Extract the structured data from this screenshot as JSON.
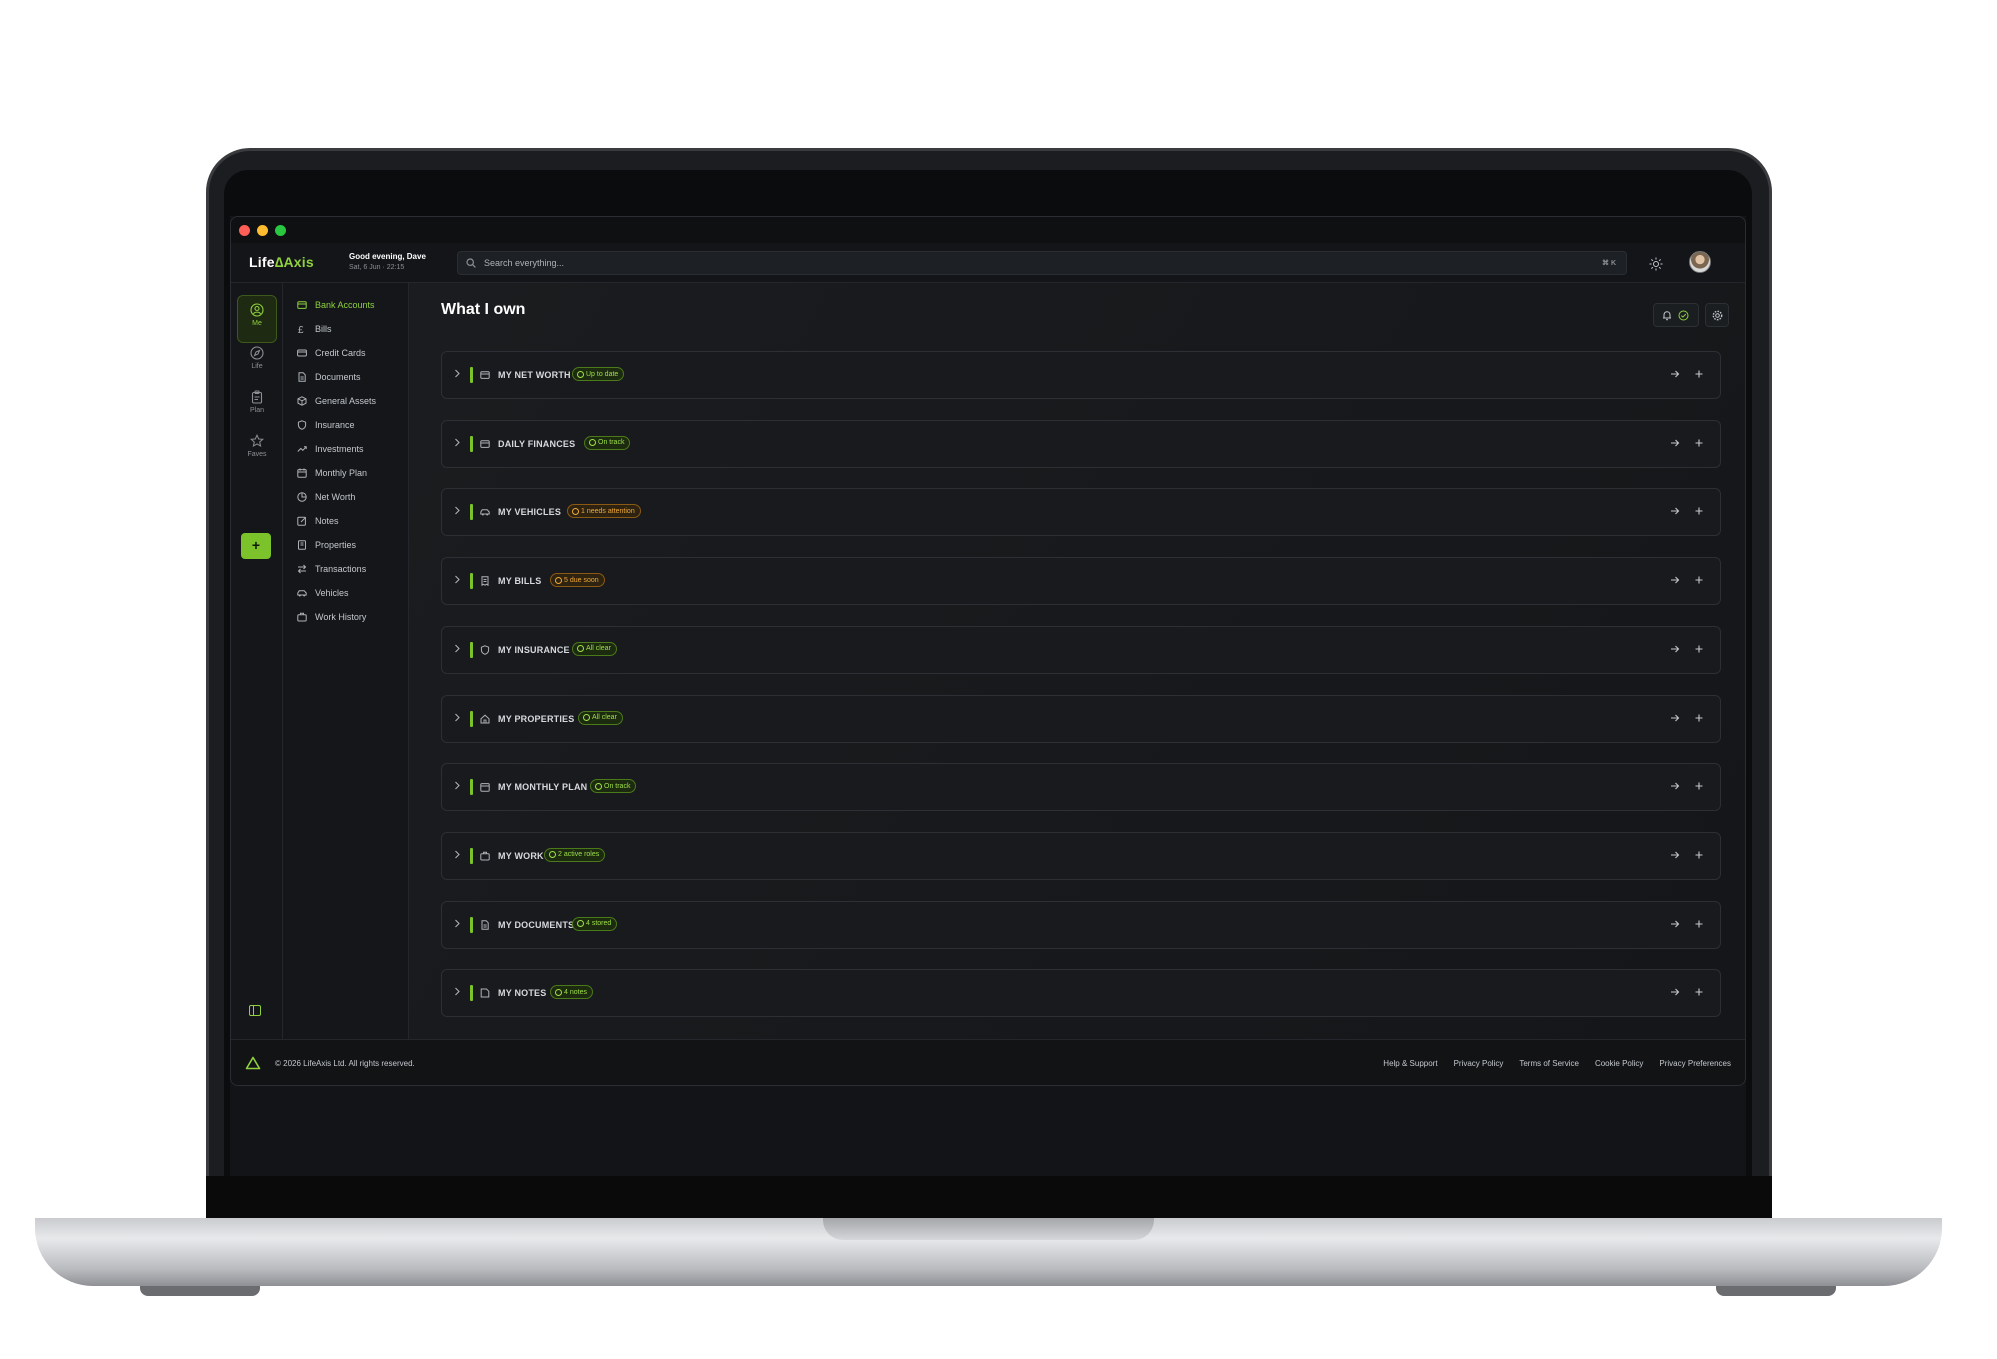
{
  "app": {
    "brand_prefix": "Life",
    "brand_suffix": "Axis",
    "greeting": "Good evening, Dave",
    "date": "Sat, 6 Jun · 22:15"
  },
  "search": {
    "placeholder": "Search everything...",
    "shortcut": "⌘ K"
  },
  "rail": {
    "items": [
      {
        "label": "Me",
        "icon": "user-icon"
      },
      {
        "label": "Life",
        "icon": "compass-icon"
      },
      {
        "label": "Plan",
        "icon": "clipboard-icon"
      },
      {
        "label": "Faves",
        "icon": "star-icon"
      }
    ],
    "add_label": "+"
  },
  "sidebar": {
    "items": [
      {
        "label": "Bank Accounts",
        "icon": "wallet-icon",
        "active": true
      },
      {
        "label": "Bills",
        "icon": "pound-icon"
      },
      {
        "label": "Credit Cards",
        "icon": "card-icon"
      },
      {
        "label": "Documents",
        "icon": "document-icon"
      },
      {
        "label": "General Assets",
        "icon": "box-icon"
      },
      {
        "label": "Insurance",
        "icon": "shield-icon"
      },
      {
        "label": "Investments",
        "icon": "trend-icon"
      },
      {
        "label": "Monthly Plan",
        "icon": "calendar-icon"
      },
      {
        "label": "Net Worth",
        "icon": "pie-icon"
      },
      {
        "label": "Notes",
        "icon": "note-icon"
      },
      {
        "label": "Properties",
        "icon": "building-icon"
      },
      {
        "label": "Transactions",
        "icon": "swap-icon"
      },
      {
        "label": "Vehicles",
        "icon": "car-icon"
      },
      {
        "label": "Work History",
        "icon": "briefcase-icon"
      }
    ]
  },
  "main": {
    "title": "What I own",
    "sections": [
      {
        "title": "MY NET WORTH",
        "badge": "Up to date",
        "status": "ok",
        "icon": "wallet-icon"
      },
      {
        "title": "DAILY FINANCES",
        "badge": "On track",
        "status": "ok",
        "icon": "wallet-icon"
      },
      {
        "title": "MY VEHICLES",
        "badge": "1 needs attention",
        "status": "warn",
        "icon": "car-icon"
      },
      {
        "title": "MY BILLS",
        "badge": "5 due soon",
        "status": "warn",
        "icon": "receipt-icon"
      },
      {
        "title": "MY INSURANCE",
        "badge": "All clear",
        "status": "ok",
        "icon": "shield-icon"
      },
      {
        "title": "MY PROPERTIES",
        "badge": "All clear",
        "status": "ok",
        "icon": "home-icon"
      },
      {
        "title": "MY MONTHLY PLAN",
        "badge": "On track",
        "status": "ok",
        "icon": "calendar-icon"
      },
      {
        "title": "MY WORK",
        "badge": "2 active roles",
        "status": "ok",
        "icon": "briefcase-icon"
      },
      {
        "title": "MY DOCUMENTS",
        "badge": "4 stored",
        "status": "ok",
        "icon": "document-icon"
      },
      {
        "title": "MY NOTES",
        "badge": "4 notes",
        "status": "ok",
        "icon": "note-icon"
      }
    ]
  },
  "footer": {
    "copyright": "© 2026 LifeAxis Ltd. All rights reserved.",
    "links": [
      "Help & Support",
      "Privacy Policy",
      "Terms of Service",
      "Cookie Policy",
      "Privacy Preferences"
    ]
  },
  "colors": {
    "accent": "#8fd13f",
    "warning": "#f0a93a",
    "chat": "#5856d6",
    "background": "#16181b"
  }
}
